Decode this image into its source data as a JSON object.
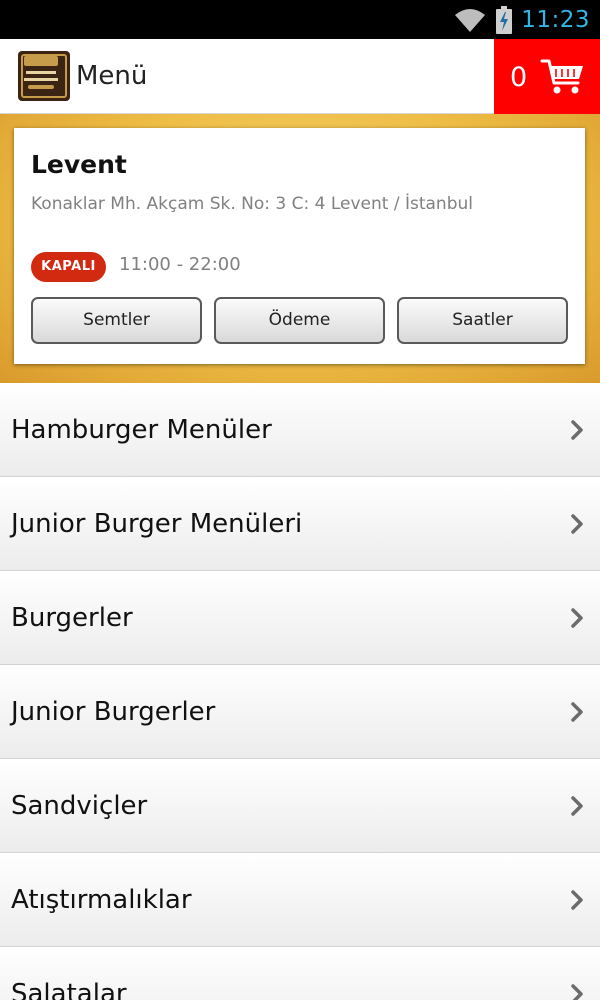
{
  "status_bar": {
    "time": "11:23",
    "icons": [
      "wifi-icon",
      "battery-charging-icon"
    ],
    "time_color": "#33b5e5"
  },
  "action_bar": {
    "title": "Menü",
    "logo_icon": "route-burger-logo",
    "cart_count": "0",
    "cart_icon": "shopping-cart-icon",
    "cart_color": "#ff0000"
  },
  "branch": {
    "name": "Levent",
    "address": "Konaklar Mh. Akçam Sk. No: 3 C: 4 Levent / İstanbul",
    "status": "KAPALI",
    "status_color": "#d22a10",
    "hours": "11:00 - 22:00",
    "buttons": [
      "Semtler",
      "Ödeme",
      "Saatler"
    ]
  },
  "categories": [
    "Hamburger Menüler",
    "Junior Burger Menüleri",
    "Burgerler",
    "Junior Burgerler",
    "Sandviçler",
    "Atıştırmalıklar",
    "Salatalar"
  ],
  "list_icon": "chevron-right-icon"
}
